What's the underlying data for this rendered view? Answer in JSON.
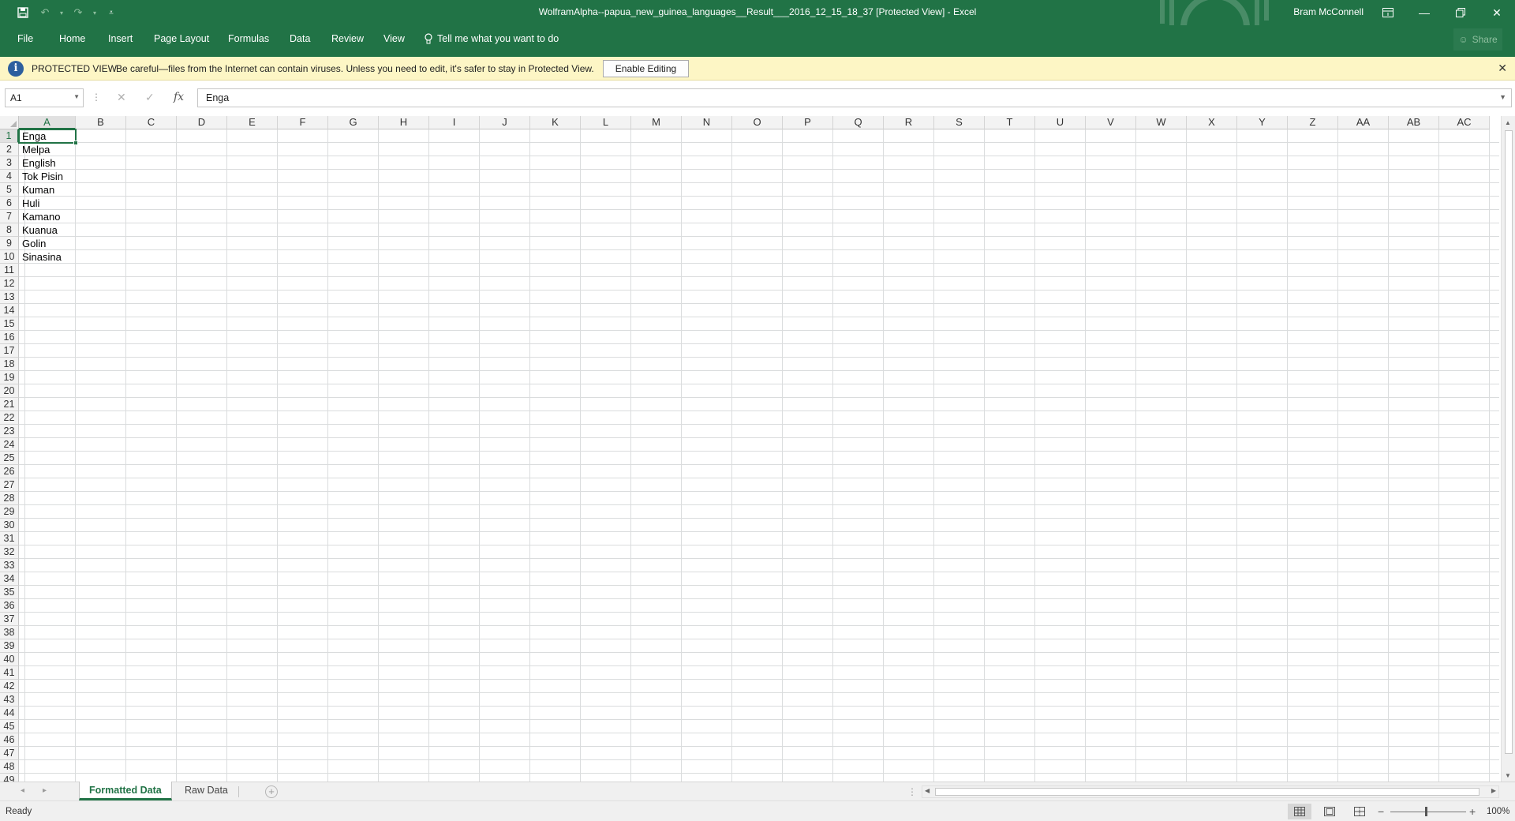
{
  "window": {
    "title": "WolframAlpha--papua_new_guinea_languages__Result___2016_12_15_18_37  [Protected View] - Excel",
    "user": "Bram McConnell",
    "share_label": "Share"
  },
  "ribbon": {
    "tabs": [
      "File",
      "Home",
      "Insert",
      "Page Layout",
      "Formulas",
      "Data",
      "Review",
      "View"
    ],
    "tell_me": "Tell me what you want to do"
  },
  "protected_view": {
    "title": "PROTECTED VIEW",
    "message": "Be careful—files from the Internet can contain viruses. Unless you need to edit, it's safer to stay in Protected View.",
    "enable_label": "Enable Editing"
  },
  "formula_bar": {
    "name_box": "A1",
    "fx": "fx",
    "value": "Enga"
  },
  "grid": {
    "columns": [
      "A",
      "B",
      "C",
      "D",
      "E",
      "F",
      "G",
      "H",
      "I",
      "J",
      "K",
      "L",
      "M",
      "N",
      "O",
      "P",
      "Q",
      "R",
      "S",
      "T",
      "U",
      "V",
      "W",
      "X",
      "Y",
      "Z",
      "AA",
      "AB",
      "AC"
    ],
    "row_count": 49,
    "column_a_values": [
      "Enga",
      "Melpa",
      "English",
      "Tok Pisin",
      "Kuman",
      "Huli",
      "Kamano",
      "Kuanua",
      "Golin",
      "Sinasina"
    ],
    "active_cell": "A1"
  },
  "sheets": {
    "tabs": [
      "Formatted Data",
      "Raw Data"
    ],
    "active": "Formatted Data"
  },
  "status": {
    "text": "Ready",
    "zoom": "100%"
  },
  "colors": {
    "accent": "#217346",
    "protected_bar": "#fdf6c5"
  }
}
